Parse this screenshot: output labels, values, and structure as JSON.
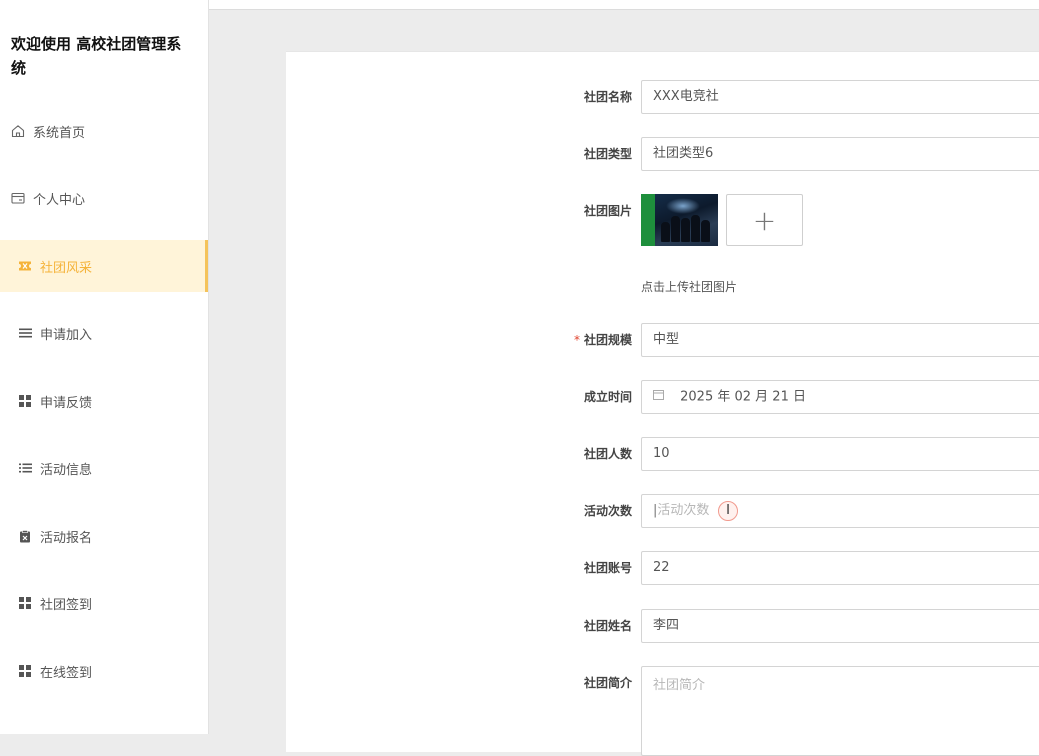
{
  "app": {
    "brand_title": "欢迎使用 高校社团管理系统"
  },
  "sidebar": {
    "items": [
      {
        "label": "系统首页",
        "icon": "home-icon"
      },
      {
        "label": "个人中心",
        "icon": "card-icon"
      },
      {
        "label": "社团风采",
        "icon": "ticket-icon",
        "active": true
      },
      {
        "label": "申请加入",
        "icon": "menu-lines-icon"
      },
      {
        "label": "申请反馈",
        "icon": "grid-icon"
      },
      {
        "label": "活动信息",
        "icon": "list-icon"
      },
      {
        "label": "活动报名",
        "icon": "clipboard-x-icon"
      },
      {
        "label": "社团签到",
        "icon": "grid-icon"
      },
      {
        "label": "在线签到",
        "icon": "grid-icon"
      }
    ]
  },
  "form": {
    "name": {
      "label": "社团名称",
      "value": "XXX电竞社"
    },
    "type": {
      "label": "社团类型",
      "value": "社团类型6"
    },
    "image": {
      "label": "社团图片",
      "upload_symbol": "+",
      "hint": "点击上传社团图片"
    },
    "scale": {
      "label": "社团规模",
      "required_mark": "*",
      "value": "中型"
    },
    "founded": {
      "label": "成立时间",
      "value": "2025 年 02 月 21 日"
    },
    "members": {
      "label": "社团人数",
      "value": "10"
    },
    "activities": {
      "label": "活动次数",
      "placeholder": "活动次数",
      "value": ""
    },
    "account": {
      "label": "社团账号",
      "value": "22"
    },
    "owner_name": {
      "label": "社团姓名",
      "value": "李四"
    },
    "intro": {
      "label": "社团简介",
      "placeholder": "社团简介"
    }
  },
  "colors": {
    "accent": "#f5b33a",
    "active_bg": "#fff1cf",
    "required": "#e0442e"
  }
}
